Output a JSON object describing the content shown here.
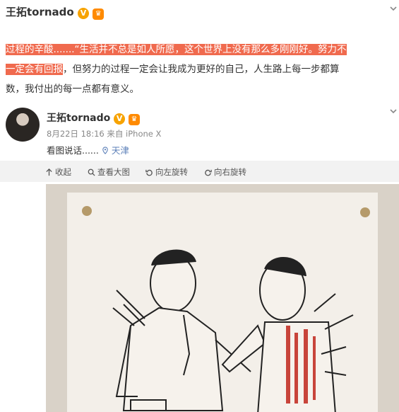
{
  "quoted_post": {
    "author": "王拓tornado",
    "verified_badge": "V",
    "excerpt_highlight_1": "过程的辛酸.......“生活并不总是如人所愿，这个世界上没有那么多刚刚好。努力不",
    "excerpt_highlight_2": "一定会有回报",
    "excerpt_rest_1": "，但努力的过程一定会让我成为更好的自己，人生路上每一步都算",
    "excerpt_rest_2": "数，我付出的每一点都有意义。"
  },
  "repost": {
    "author": "王拓tornado",
    "verified_badge": "V",
    "meta": "8月22日 18:16 来自 iPhone X",
    "caption": "看图说话......",
    "location": "天津"
  },
  "toolbar": {
    "collapse": "收起",
    "view_large": "查看大图",
    "rotate_left": "向左旋转",
    "rotate_right": "向右旋转"
  },
  "colors": {
    "highlight": "#f06a4e",
    "badge": "#f7a300",
    "link": "#5b7fb8"
  }
}
